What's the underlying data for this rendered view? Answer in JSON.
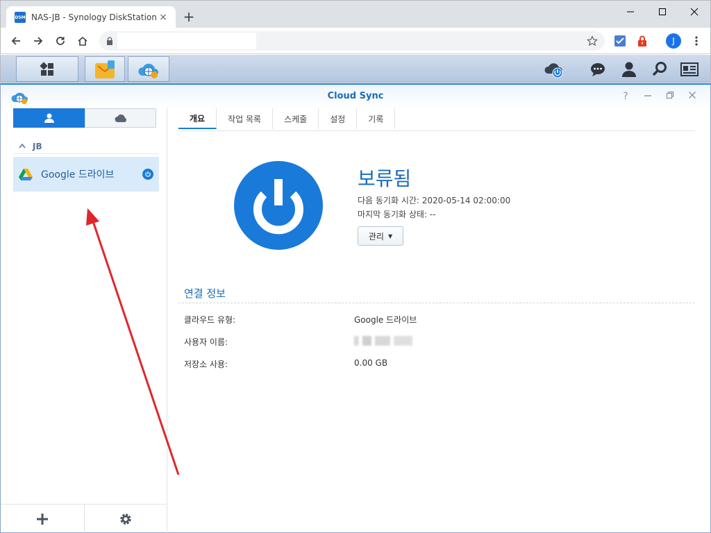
{
  "browser": {
    "tab": {
      "favicon_text": "DSM",
      "title": "NAS-JB - Synology DiskStation"
    },
    "avatar_letter": "J"
  },
  "app": {
    "title": "Cloud Sync",
    "left": {
      "group": "JB",
      "tasks": [
        {
          "label": "Google 드라이브"
        }
      ]
    },
    "tabs": [
      {
        "label": "개요",
        "active": true
      },
      {
        "label": "작업 목록"
      },
      {
        "label": "스케줄"
      },
      {
        "label": "설정"
      },
      {
        "label": "기록"
      }
    ],
    "status": {
      "title": "보류됨",
      "next_sync": "다음 동기화 시간: 2020-05-14 02:00:00",
      "last_status": "마지막 동기화 상태: --",
      "manage_label": "관리"
    },
    "connection": {
      "section_title": "연결 정보",
      "rows": [
        {
          "label": "클라우드 유형:",
          "value": "Google 드라이브"
        },
        {
          "label": "사용자 이름:",
          "value": ""
        },
        {
          "label": "저장소 사용:",
          "value": "0.00 GB"
        }
      ]
    }
  },
  "colors": {
    "accent": "#1a7ad9",
    "title_blue": "#1a6cb8",
    "annotation_arrow": "#e0262b"
  }
}
